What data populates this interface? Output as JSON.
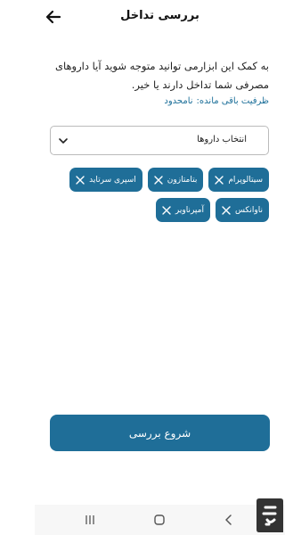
{
  "header": {
    "title": "بررسی تداخل"
  },
  "description": "به کمک این ابزارمی توانید متوجه شوید آیا داروهای مصرفی شما تداخل دارند یا خیر.",
  "capacity": {
    "label": "ظرفیت باقی مانده:",
    "value": "نامحدود"
  },
  "select": {
    "label": "انتخاب داروها"
  },
  "chips": [
    "سیتالوپرام",
    "بتامتازون",
    "اسپری سرتاید",
    "ناوانکس",
    "آمپرناویر"
  ],
  "start_button": "شروع بررسی",
  "colors": {
    "accent": "#1f6e98",
    "capacity_text": "#1c6f99"
  }
}
